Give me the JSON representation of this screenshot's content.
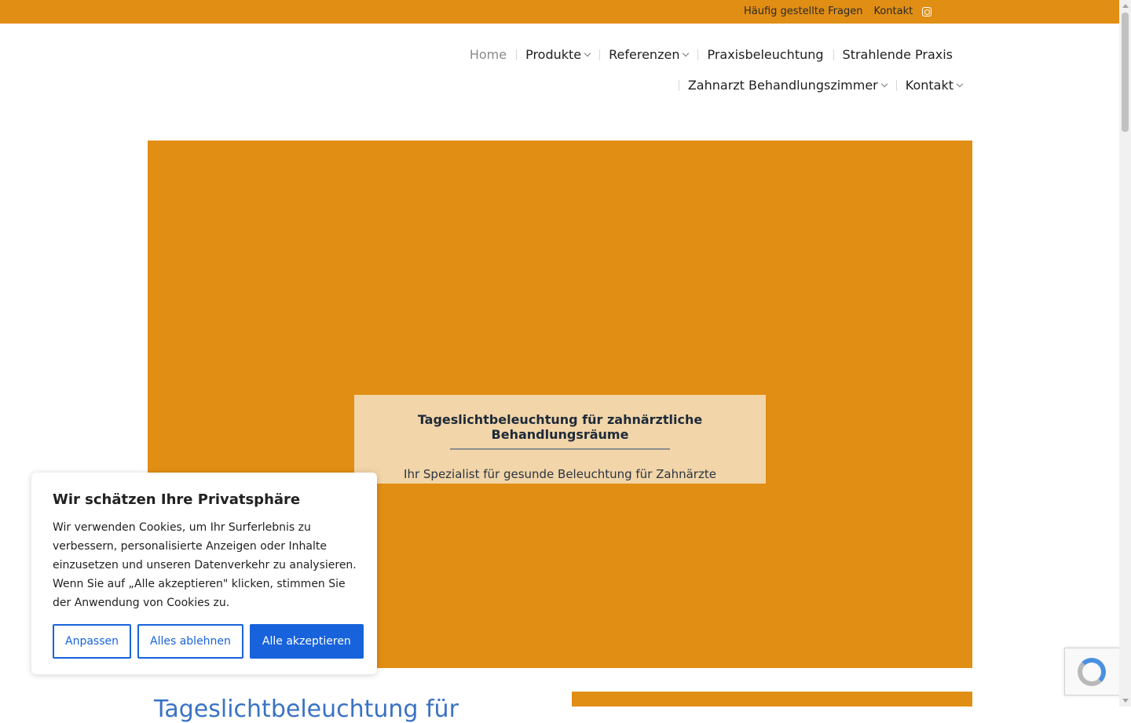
{
  "topbar": {
    "faq": "Häufig gestellte Fragen",
    "contact": "Kontakt",
    "instagram_icon": "instagram-icon"
  },
  "nav": {
    "row1": [
      {
        "label": "Home",
        "active": true,
        "dropdown": false
      },
      {
        "label": "Produkte",
        "dropdown": true
      },
      {
        "label": "Referenzen",
        "dropdown": true
      },
      {
        "label": "Praxisbeleuchtung",
        "dropdown": false
      },
      {
        "label": "Strahlende Praxis",
        "dropdown": false
      }
    ],
    "row2": [
      {
        "label": "Zahnarzt Behandlungszimmer",
        "dropdown": true
      },
      {
        "label": "Kontakt",
        "dropdown": true
      }
    ]
  },
  "hero": {
    "title": "Tageslichtbeleuchtung für zahnärztliche Behandlungsräume",
    "subtitle": "Ihr Spezialist für gesunde Beleuchtung für Zahnärzte",
    "background_color": "#e18e14"
  },
  "below": {
    "heading_partial": "Tageslichtbeleuchtung für"
  },
  "cookie": {
    "title": "Wir schätzen Ihre Privatsphäre",
    "text": "Wir verwenden Cookies, um Ihr Surferlebnis zu verbessern, personalisierte Anzeigen oder Inhalte einzusetzen und unseren Datenverkehr zu analysieren. Wenn Sie auf „Alle akzeptieren\" klicken, stimmen Sie der Anwendung von Cookies zu.",
    "buttons": {
      "customize": "Anpassen",
      "reject": "Alles ablehnen",
      "accept": "Alle akzeptieren"
    },
    "accent_color": "#1863dc"
  },
  "colors": {
    "brand": "#e18e14",
    "link_blue": "#3a72c4"
  }
}
